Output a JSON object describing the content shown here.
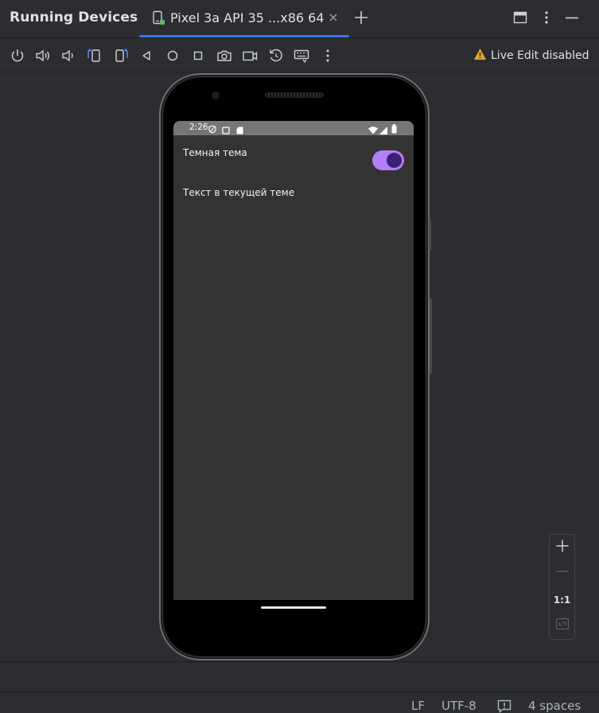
{
  "header": {
    "panel_title": "Running Devices",
    "tab_label": "Pixel 3a API 35 ...x86 64",
    "accent": "#3574f0"
  },
  "toolbar": {
    "buttons": [
      "power-icon",
      "volume-up-icon",
      "volume-down-icon",
      "rotate-left-icon",
      "rotate-right-icon",
      "back-icon",
      "home-icon",
      "overview-icon",
      "screenshot-icon",
      "screen-record-icon",
      "reset-icon",
      "keyboard-icon",
      "more-vertical-icon"
    ],
    "live_edit_label": "Live Edit disabled",
    "warning_color": "#e0a632"
  },
  "device": {
    "status_time": "2:26",
    "dark_theme_label": "Темная тема",
    "dark_theme_on": true,
    "current_theme_text": "Текст в текущей теме",
    "switch_color": "#b17ff6"
  },
  "zoom": {
    "one_to_one": "1:1"
  },
  "statusbar": {
    "line_sep": "LF",
    "encoding": "UTF-8",
    "indent": "4 spaces"
  }
}
